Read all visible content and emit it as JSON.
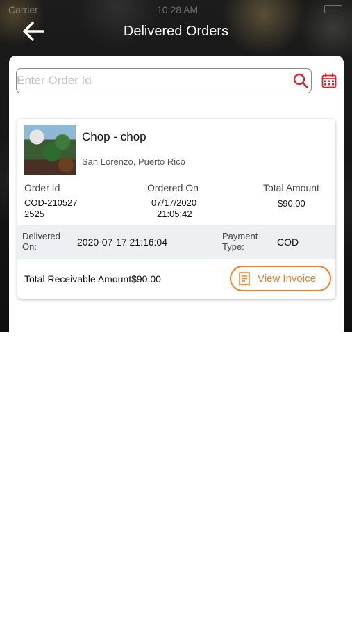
{
  "status_bar": {
    "time": "10:28 AM",
    "carrier": "Carrier"
  },
  "header": {
    "title": "Delivered Orders"
  },
  "search": {
    "placeholder": "Enter Order Id",
    "value": ""
  },
  "order": {
    "restaurant_name": "Chop - chop",
    "location": "San Lorenzo, Puerto Rico",
    "order_id_label": "Order Id",
    "order_id_line1": "COD-210527",
    "order_id_line2": "2525",
    "ordered_on_label": "Ordered On",
    "ordered_on_date": "07/17/2020",
    "ordered_on_time": "21:05:42",
    "total_amount_label": "Total Amount",
    "total_amount": "$90.00",
    "delivered_on_label_line1": "Delivered",
    "delivered_on_label_line2": "On:",
    "delivered_on": "2020-07-17 21:16:04",
    "payment_type_label_line1": "Payment",
    "payment_type_label_line2": "Type:",
    "payment_type": "COD",
    "total_receivable": "Total Receivable Amount$90.00",
    "view_invoice_label": "View Invoice"
  },
  "colors": {
    "accent": "#ef7d2a",
    "danger_icon": "#d0262e",
    "band": "#eeeff3"
  },
  "icons": [
    "back-arrow-icon",
    "search-icon",
    "calendar-icon",
    "receipt-icon"
  ]
}
